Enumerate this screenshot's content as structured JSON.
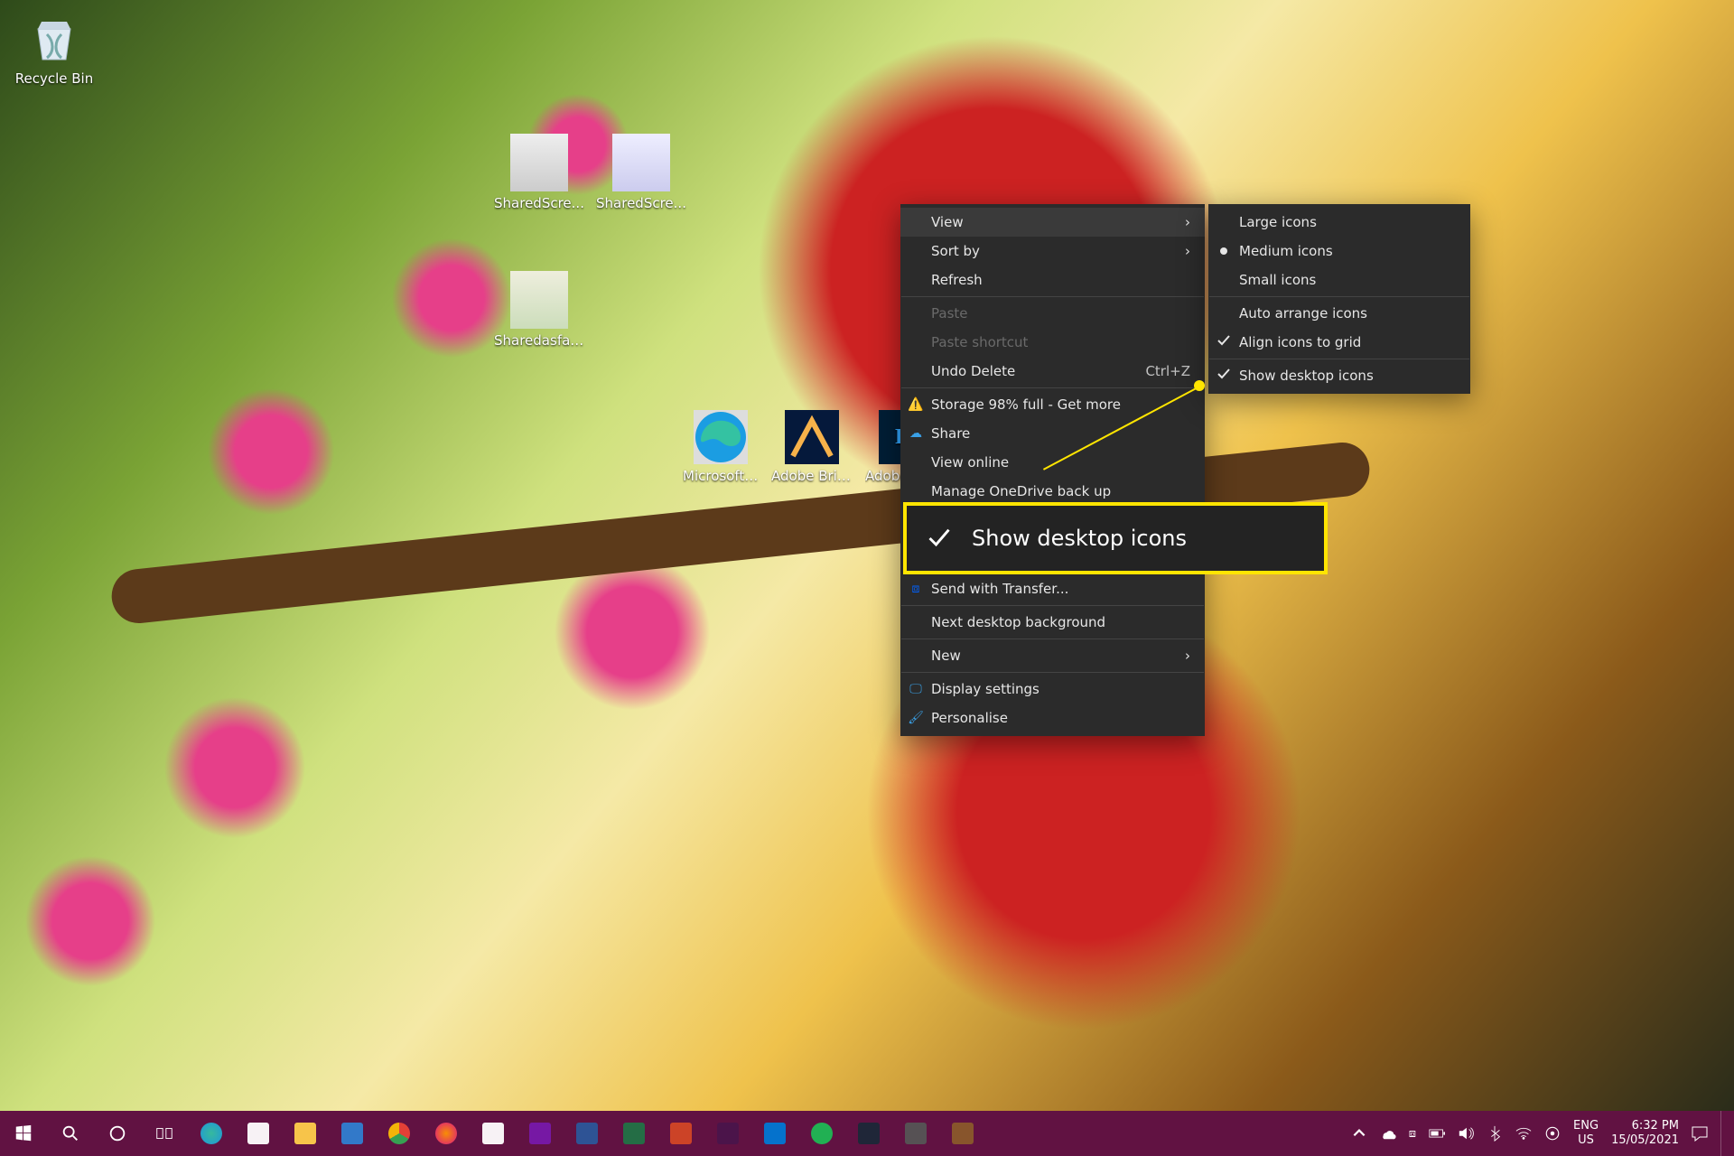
{
  "desktop_icons": {
    "recycle_bin": "Recycle Bin",
    "shared1": "SharedScre...",
    "shared2": "SharedScre...",
    "shared3": "Sharedasfas...",
    "edge": "Microsoft Edge",
    "bridge": "Adobe Bridge",
    "photoshop": "Adobe Photoshop"
  },
  "context_menu": {
    "view": "View",
    "sort_by": "Sort by",
    "refresh": "Refresh",
    "paste": "Paste",
    "paste_shortcut": "Paste shortcut",
    "undo_delete": "Undo Delete",
    "undo_delete_cue": "Ctrl+Z",
    "storage": "Storage 98% full - Get more",
    "share": "Share",
    "view_online": "View online",
    "manage_onedrive": "Manage OneDrive back up",
    "send_transfer": "Send with Transfer...",
    "next_bg": "Next desktop background",
    "new": "New",
    "display_settings": "Display settings",
    "personalise": "Personalise"
  },
  "view_submenu": {
    "large": "Large icons",
    "medium": "Medium icons",
    "small": "Small icons",
    "auto_arrange": "Auto arrange icons",
    "align_grid": "Align icons to grid",
    "show_icons": "Show desktop icons"
  },
  "callout": "Show desktop icons",
  "taskbar": {
    "lang1": "ENG",
    "lang2": "US",
    "time": "6:32 PM",
    "date": "15/05/2021"
  }
}
